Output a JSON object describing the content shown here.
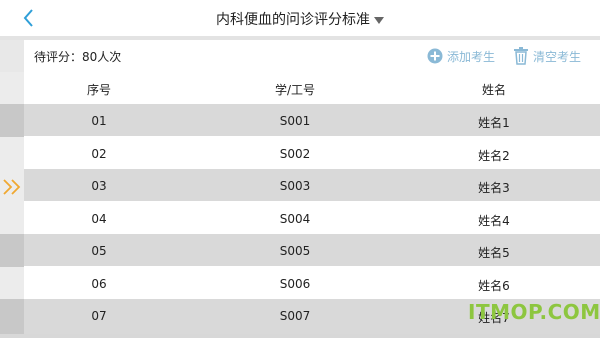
{
  "header": {
    "title": "内科便血的问诊评分标准"
  },
  "toolbar": {
    "pending": "待评分：80人次",
    "add_label": "添加考生",
    "clear_label": "清空考生"
  },
  "table": {
    "columns": [
      "序号",
      "学/工号",
      "姓名"
    ],
    "rows": [
      {
        "no": "01",
        "id": "S001",
        "name": "姓名1"
      },
      {
        "no": "02",
        "id": "S002",
        "name": "姓名2"
      },
      {
        "no": "03",
        "id": "S003",
        "name": "姓名3"
      },
      {
        "no": "04",
        "id": "S004",
        "name": "姓名4"
      },
      {
        "no": "05",
        "id": "S005",
        "name": "姓名5"
      },
      {
        "no": "06",
        "id": "S006",
        "name": "姓名6"
      },
      {
        "no": "07",
        "id": "S007",
        "name": "姓名7"
      }
    ],
    "selected_row": "03"
  },
  "watermark": "ITMOP.COM",
  "colors": {
    "accent": "#2f9fd8",
    "row_alt": "#d9d9d9",
    "marker": "#f0a830",
    "watermark": "#8dc63f"
  }
}
